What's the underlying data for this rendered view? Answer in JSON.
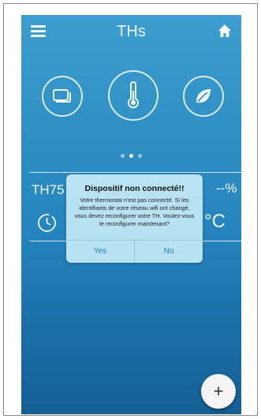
{
  "header": {
    "title": "THs",
    "menu_icon": "hamburger-menu-icon",
    "home_icon": "home-icon"
  },
  "modes": [
    {
      "icon": "screen-icon"
    },
    {
      "icon": "thermometer-icon"
    },
    {
      "icon": "leaf-icon"
    }
  ],
  "pager": {
    "count": 3,
    "active": 1
  },
  "device": {
    "name": "TH75",
    "humidity": "--%",
    "temp_unit": "°C"
  },
  "dialog": {
    "title": "Dispositif non connecté!!",
    "message": "Votre thermostat n'est pas connecté. Si les identifiants de votre réseau wifi ont changé, vous devez reconfigurer votre TH. Voulez-vous le reconfigurer maintenant?",
    "yes_label": "Yes",
    "no_label": "No"
  },
  "fab": {
    "label": "+"
  },
  "colors": {
    "accent": "#1f7fc0",
    "background_top": "#3e9ecf",
    "background_bottom": "#155f95"
  }
}
